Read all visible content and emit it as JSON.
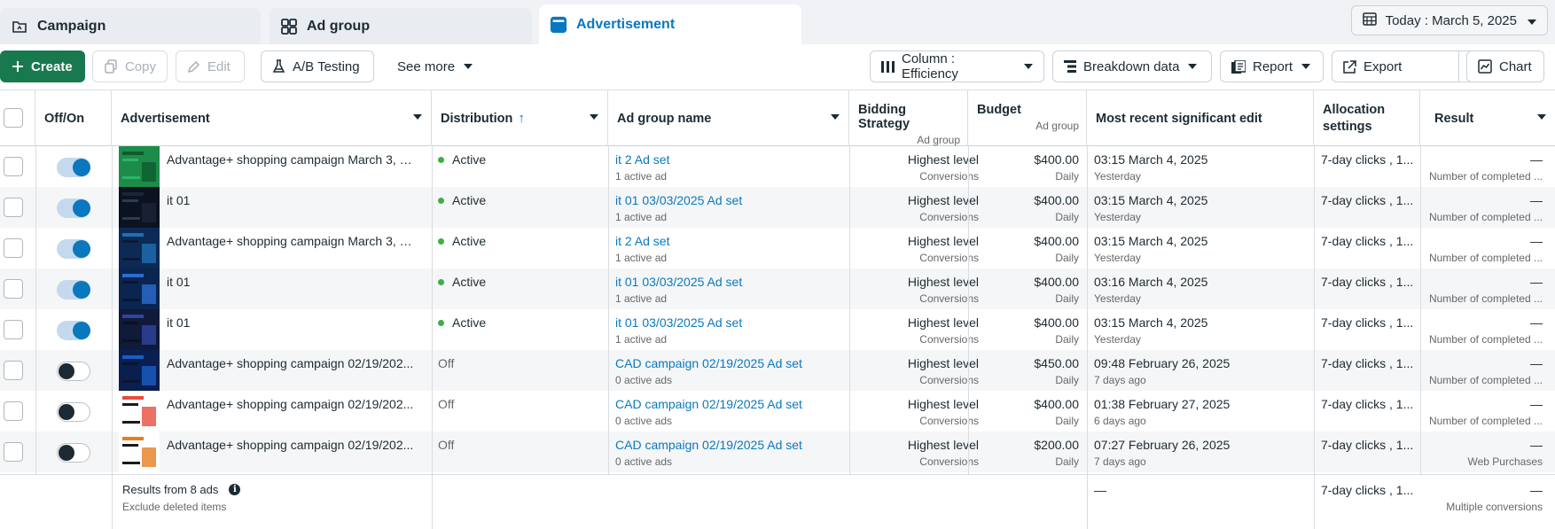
{
  "tabs": [
    {
      "label": "Campaign",
      "icon": "campaign-icon"
    },
    {
      "label": "Ad group",
      "icon": "ad-group-icon"
    },
    {
      "label": "Advertisement",
      "icon": "advertisement-icon"
    }
  ],
  "date_range": "Today : March 5, 2025",
  "toolbar": {
    "create": "Create",
    "copy": "Copy",
    "edit": "Edit",
    "ab_testing": "A/B Testing",
    "see_more": "See more",
    "columns": "Column : Efficiency",
    "breakdown": "Breakdown data",
    "report": "Report",
    "export": "Export",
    "chart": "Chart"
  },
  "columns": {
    "off_on": "Off/On",
    "advertisement": "Advertisement",
    "distribution": "Distribution",
    "ad_group_name": "Ad group name",
    "bidding_strategy": "Bidding Strategy",
    "bidding_sub": "Ad group",
    "budget": "Budget",
    "budget_sub": "Ad group",
    "recent_edit": "Most recent significant edit",
    "allocation": "Allocation settings",
    "result": "Result"
  },
  "rows": [
    {
      "on": true,
      "name": "Advantage+ shopping campaign March 3, 2...",
      "dist": "Active",
      "group": "it 2 Ad set",
      "group_sub": "1 active ad",
      "bid": "Highest level",
      "bid_sub": "Conversions",
      "budget": "$400.00",
      "budget_sub": "Daily",
      "edit": "03:15 March 4, 2025",
      "edit_sub": "Yesterday",
      "alloc": "7-day clicks , 1...",
      "result": "—",
      "result_sub": "Number of completed ..."
    },
    {
      "on": true,
      "name": "it 01",
      "dist": "Active",
      "group": "it 01 03/03/2025 Ad set",
      "group_sub": "1 active ad",
      "bid": "Highest level",
      "bid_sub": "Conversions",
      "budget": "$400.00",
      "budget_sub": "Daily",
      "edit": "03:15 March 4, 2025",
      "edit_sub": "Yesterday",
      "alloc": "7-day clicks , 1...",
      "result": "—",
      "result_sub": "Number of completed ..."
    },
    {
      "on": true,
      "name": "Advantage+ shopping campaign March 3, 2...",
      "dist": "Active",
      "group": "it 2 Ad set",
      "group_sub": "1 active ad",
      "bid": "Highest level",
      "bid_sub": "Conversions",
      "budget": "$400.00",
      "budget_sub": "Daily",
      "edit": "03:15 March 4, 2025",
      "edit_sub": "Yesterday",
      "alloc": "7-day clicks , 1...",
      "result": "—",
      "result_sub": "Number of completed ..."
    },
    {
      "on": true,
      "name": "it 01",
      "dist": "Active",
      "group": "it 01 03/03/2025 Ad set",
      "group_sub": "1 active ad",
      "bid": "Highest level",
      "bid_sub": "Conversions",
      "budget": "$400.00",
      "budget_sub": "Daily",
      "edit": "03:16 March 4, 2025",
      "edit_sub": "Yesterday",
      "alloc": "7-day clicks , 1...",
      "result": "—",
      "result_sub": "Number of completed ..."
    },
    {
      "on": true,
      "name": "it 01",
      "dist": "Active",
      "group": "it 01 03/03/2025 Ad set",
      "group_sub": "1 active ad",
      "bid": "Highest level",
      "bid_sub": "Conversions",
      "budget": "$400.00",
      "budget_sub": "Daily",
      "edit": "03:15 March 4, 2025",
      "edit_sub": "Yesterday",
      "alloc": "7-day clicks , 1...",
      "result": "—",
      "result_sub": "Number of completed ..."
    },
    {
      "on": false,
      "name": "Advantage+ shopping campaign 02/19/202...",
      "dist": "Off",
      "group": "CAD campaign 02/19/2025 Ad set",
      "group_sub": "0 active ads",
      "bid": "Highest level",
      "bid_sub": "Conversions",
      "budget": "$450.00",
      "budget_sub": "Daily",
      "edit": "09:48 February 26, 2025",
      "edit_sub": "7 days ago",
      "alloc": "7-day clicks , 1...",
      "result": "—",
      "result_sub": "Number of completed ..."
    },
    {
      "on": false,
      "name": "Advantage+ shopping campaign 02/19/202...",
      "dist": "Off",
      "group": "CAD campaign 02/19/2025 Ad set",
      "group_sub": "0 active ads",
      "bid": "Highest level",
      "bid_sub": "Conversions",
      "budget": "$400.00",
      "budget_sub": "Daily",
      "edit": "01:38 February 27, 2025",
      "edit_sub": "6 days ago",
      "alloc": "7-day clicks , 1...",
      "result": "—",
      "result_sub": "Number of completed ..."
    },
    {
      "on": false,
      "name": "Advantage+ shopping campaign 02/19/202...",
      "dist": "Off",
      "group": "CAD campaign 02/19/2025 Ad set",
      "group_sub": "0 active ads",
      "bid": "Highest level",
      "bid_sub": "Conversions",
      "budget": "$200.00",
      "budget_sub": "Daily",
      "edit": "07:27 February 26, 2025",
      "edit_sub": "7 days ago",
      "alloc": "7-day clicks , 1...",
      "result": "—",
      "result_sub": "Web Purchases"
    }
  ],
  "footer": {
    "results": "Results from 8 ads",
    "exclude": "Exclude deleted items",
    "edit": "—",
    "alloc": "7-day clicks , 1...",
    "result": "—",
    "result_sub": "Multiple conversions"
  },
  "colors": {
    "accent": "#0a78be",
    "create": "#18794e",
    "active_dot": "#3cb043"
  }
}
